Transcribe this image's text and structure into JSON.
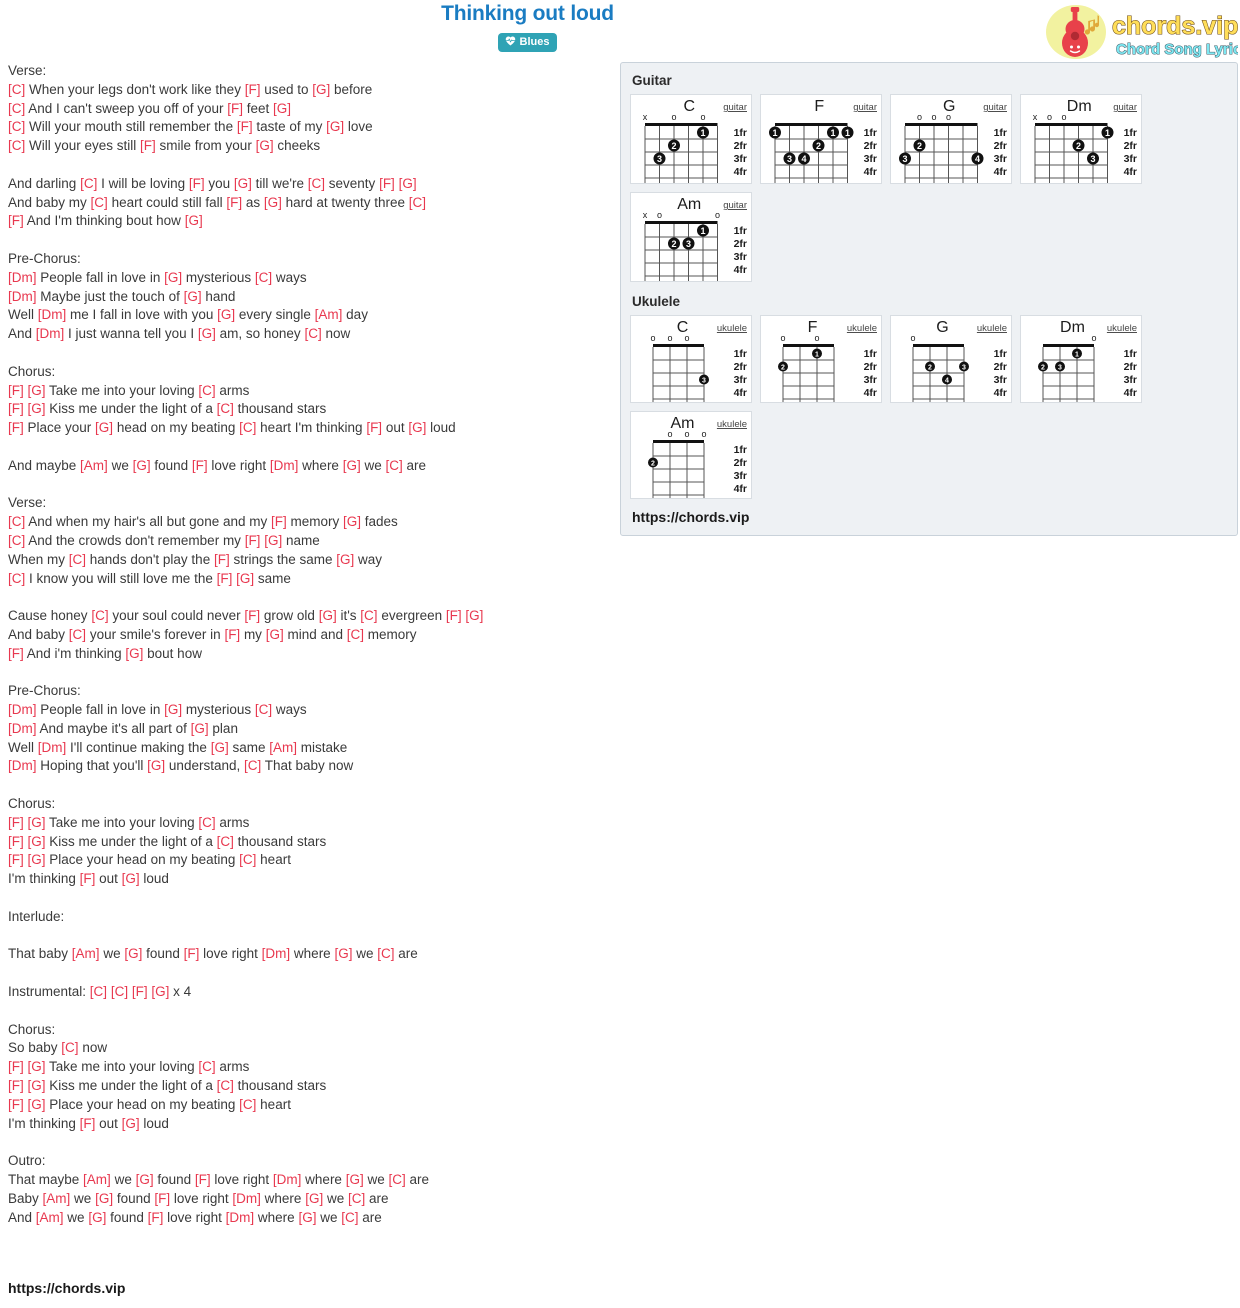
{
  "header": {
    "title": "Thinking out loud",
    "genre_badge": "Blues",
    "badge_icon": "heart-pulse-icon",
    "badge_color": "#2fa3b5",
    "title_color": "#1a7cc2"
  },
  "logo": {
    "brand": "chords.vip",
    "tagline": "Chord Song Lyric",
    "icon": "guitar-icon",
    "brand_color": "#ffde59",
    "tagline_color": "#7ee8f2",
    "circle_color": "#f2f2a0"
  },
  "chord_color": "#e8384f",
  "lyrics": [
    "Verse:",
    "[C] When your legs don't work like they [F] used to [G] before",
    "[C] And I can't sweep you off of your [F] feet [G]",
    "[C] Will your mouth still remember the [F] taste of my [G] love",
    "[C] Will your eyes still [F] smile from your [G] cheeks",
    "",
    "And darling [C] I will be loving [F] you [G] till we're [C] seventy [F] [G]",
    "And baby my [C] heart could still fall [F] as [G] hard at twenty three [C]",
    "[F] And I'm thinking bout how [G]",
    "",
    "Pre-Chorus:",
    "[Dm] People fall in love in [G] mysterious [C] ways",
    "[Dm] Maybe just the touch of [G] hand",
    "Well [Dm] me I fall in love with you [G] every single [Am] day",
    "And [Dm] I just wanna tell you I [G] am, so honey [C] now",
    "",
    "Chorus:",
    "[F] [G] Take me into your loving [C] arms",
    "[F] [G] Kiss me under the light of a [C] thousand stars",
    "[F] Place your [G] head on my beating [C] heart I'm thinking [F] out [G] loud",
    "",
    "And maybe [Am] we [G] found [F] love right [Dm] where [G] we [C] are",
    "",
    "Verse:",
    "[C] And when my hair's all but gone and my [F] memory [G] fades",
    "[C] And the crowds don't remember my [F] [G] name",
    "When my [C] hands don't play the [F] strings the same [G] way",
    "[C] I know you will still love me the [F] [G] same",
    "",
    "Cause honey [C] your soul could never [F] grow old [G] it's [C] evergreen [F] [G]",
    "And baby [C] your smile's forever in [F] my [G] mind and [C] memory",
    "[F] And i'm thinking [G] bout how",
    "",
    "Pre-Chorus:",
    "[Dm] People fall in love in [G] mysterious [C] ways",
    "[Dm] And maybe it's all part of [G] plan",
    "Well [Dm] I'll continue making the [G] same [Am] mistake",
    "[Dm] Hoping that you'll [G] understand, [C] That baby now",
    "",
    "Chorus:",
    "[F] [G] Take me into your loving [C] arms",
    "[F] [G] Kiss me under the light of a [C] thousand stars",
    "[F] [G] Place your head on my beating [C] heart",
    "I'm thinking [F] out [G] loud",
    "",
    "Interlude:",
    "",
    "That baby [Am] we [G] found [F] love right [Dm] where [G] we [C] are",
    "",
    "Instrumental: [C] [C] [F] [G] x 4",
    "",
    "Chorus:",
    "So baby [C] now",
    "[F] [G] Take me into your loving [C] arms",
    "[F] [G] Kiss me under the light of a [C] thousand stars",
    "[F] [G] Place your head on my beating [C] heart",
    "I'm thinking [F] out [G] loud",
    "",
    "Outro:",
    "That maybe [Am] we [G] found [F] love right [Dm] where [G] we [C] are",
    "Baby [Am] we [G] found [F] love right [Dm] where [G] we [C] are",
    "And [Am] we [G] found [F] love right [Dm] where [G] we [C] are"
  ],
  "footer_url": "https://chords.vip",
  "chord_panel": {
    "panel_url": "https://chords.vip",
    "fret_labels": [
      "1fr",
      "2fr",
      "3fr",
      "4fr"
    ],
    "guitar": {
      "heading": "Guitar",
      "instrument_tag": "guitar",
      "chords": [
        {
          "name": "C",
          "open_markers": [
            "x",
            "",
            "o",
            "",
            "o",
            ""
          ],
          "dots": [
            {
              "string": 5,
              "fret": 1,
              "finger": "1"
            },
            {
              "string": 3,
              "fret": 2,
              "finger": "2"
            },
            {
              "string": 2,
              "fret": 3,
              "finger": "3"
            }
          ]
        },
        {
          "name": "F",
          "open_markers": [
            "",
            "",
            "",
            "",
            "",
            ""
          ],
          "dots": [
            {
              "string": 1,
              "fret": 1,
              "finger": "1"
            },
            {
              "string": 5,
              "fret": 1,
              "finger": "1"
            },
            {
              "string": 6,
              "fret": 1,
              "finger": "1"
            },
            {
              "string": 4,
              "fret": 2,
              "finger": "2"
            },
            {
              "string": 2,
              "fret": 3,
              "finger": "3"
            },
            {
              "string": 3,
              "fret": 3,
              "finger": "4"
            }
          ]
        },
        {
          "name": "G",
          "open_markers": [
            "",
            "o",
            "o",
            "o",
            "",
            ""
          ],
          "dots": [
            {
              "string": 2,
              "fret": 2,
              "finger": "2"
            },
            {
              "string": 1,
              "fret": 3,
              "finger": "3"
            },
            {
              "string": 6,
              "fret": 3,
              "finger": "4"
            }
          ]
        },
        {
          "name": "Dm",
          "open_markers": [
            "x",
            "o",
            "o",
            "",
            "",
            ""
          ],
          "dots": [
            {
              "string": 6,
              "fret": 1,
              "finger": "1"
            },
            {
              "string": 4,
              "fret": 2,
              "finger": "2"
            },
            {
              "string": 5,
              "fret": 3,
              "finger": "3"
            }
          ]
        },
        {
          "name": "Am",
          "open_markers": [
            "x",
            "o",
            "",
            "",
            "",
            "o"
          ],
          "dots": [
            {
              "string": 5,
              "fret": 1,
              "finger": "1"
            },
            {
              "string": 3,
              "fret": 2,
              "finger": "2"
            },
            {
              "string": 4,
              "fret": 2,
              "finger": "3"
            }
          ]
        }
      ]
    },
    "ukulele": {
      "heading": "Ukulele",
      "instrument_tag": "ukulele",
      "chords": [
        {
          "name": "C",
          "open_markers": [
            "o",
            "o",
            "o",
            ""
          ],
          "dots": [
            {
              "string": 4,
              "fret": 3,
              "finger": "3"
            }
          ]
        },
        {
          "name": "F",
          "open_markers": [
            "o",
            "",
            "o",
            ""
          ],
          "dots": [
            {
              "string": 3,
              "fret": 1,
              "finger": "1"
            },
            {
              "string": 1,
              "fret": 2,
              "finger": "2"
            }
          ]
        },
        {
          "name": "G",
          "open_markers": [
            "o",
            "",
            "",
            ""
          ],
          "dots": [
            {
              "string": 2,
              "fret": 2,
              "finger": "2"
            },
            {
              "string": 4,
              "fret": 2,
              "finger": "3"
            },
            {
              "string": 3,
              "fret": 3,
              "finger": "4"
            }
          ]
        },
        {
          "name": "Dm",
          "open_markers": [
            "",
            "",
            "",
            "o"
          ],
          "dots": [
            {
              "string": 3,
              "fret": 1,
              "finger": "1"
            },
            {
              "string": 1,
              "fret": 2,
              "finger": "2"
            },
            {
              "string": 2,
              "fret": 2,
              "finger": "3"
            }
          ]
        },
        {
          "name": "Am",
          "open_markers": [
            "",
            "o",
            "o",
            "o"
          ],
          "dots": [
            {
              "string": 1,
              "fret": 2,
              "finger": "2"
            }
          ]
        }
      ]
    }
  }
}
